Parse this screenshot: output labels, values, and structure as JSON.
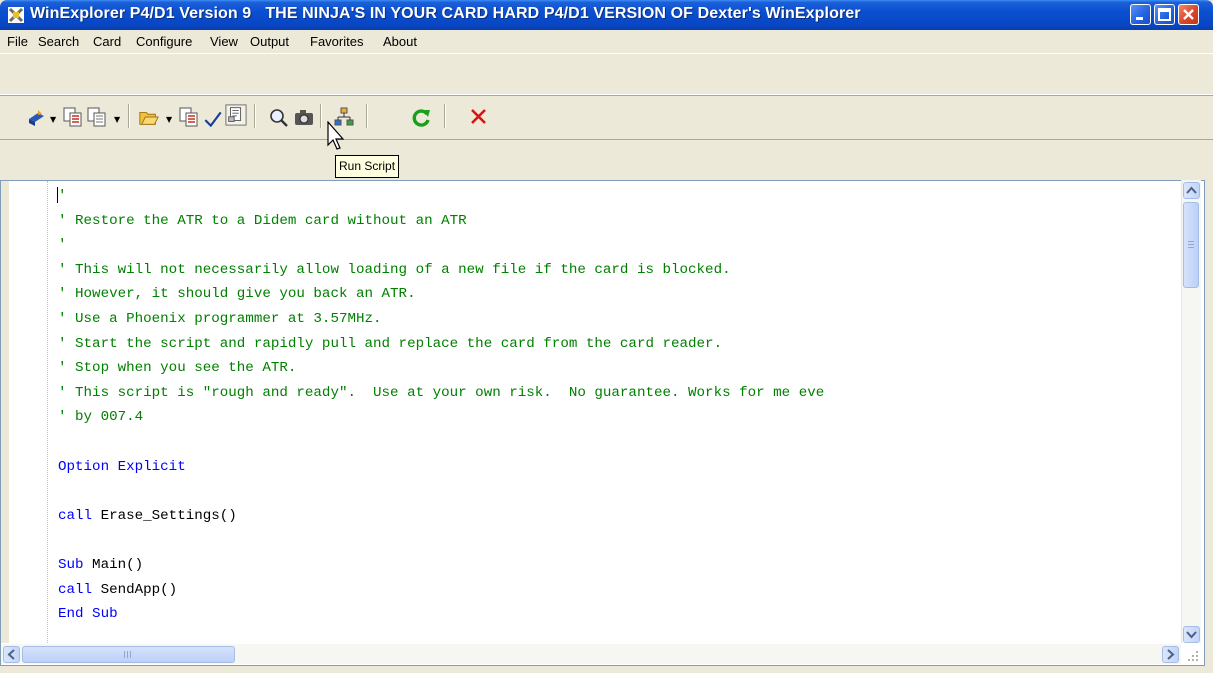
{
  "window": {
    "title_app": "WinExplorer  P4/D1  Version 9",
    "title_caption": "THE NINJA'S IN YOUR CARD HARD P4/D1 VERSION OF Dexter's WinExplorer"
  },
  "menu": {
    "items": [
      "File",
      "Search",
      "Card",
      "Configure",
      "View",
      "Output",
      "Favorites",
      "About"
    ]
  },
  "toolbar": {
    "icons": [
      "new-icon",
      "copy-file-icon",
      "duplicate-icon",
      "open-folder-icon",
      "save-icon",
      "check-icon",
      "run-script-icon",
      "search-icon",
      "camera-icon",
      "tree-icon",
      "refresh-icon",
      "stop-icon"
    ],
    "tooltip": "Run Script"
  },
  "editor": {
    "lines": [
      {
        "text": "'",
        "type": "comment"
      },
      {
        "text": "' Restore the ATR to a Didem card without an ATR",
        "type": "comment"
      },
      {
        "text": "'",
        "type": "comment"
      },
      {
        "text": "' This will not necessarily allow loading of a new file if the card is blocked.",
        "type": "comment"
      },
      {
        "text": "' However, it should give you back an ATR.",
        "type": "comment"
      },
      {
        "text": "' Use a Phoenix programmer at 3.57MHz.",
        "type": "comment"
      },
      {
        "text": "' Start the script and rapidly pull and replace the card from the card reader.",
        "type": "comment"
      },
      {
        "text": "' Stop when you see the ATR.",
        "type": "comment"
      },
      {
        "text": "' This script is \"rough and ready\".  Use at your own risk.  No guarantee. Works for me eve",
        "type": "comment"
      },
      {
        "text": "' by 007.4",
        "type": "comment"
      },
      {
        "text": "",
        "type": "plain"
      },
      {
        "text": "Option Explicit",
        "type": "keyword"
      },
      {
        "text": "",
        "type": "plain"
      },
      {
        "text": "call Erase_Settings()",
        "type": "mixed",
        "kw": "call",
        "rest": " Erase_Settings()"
      },
      {
        "text": "",
        "type": "plain"
      },
      {
        "text": "Sub Main()",
        "type": "mixed",
        "kw": "Sub",
        "rest": " Main()"
      },
      {
        "text": "call SendApp()",
        "type": "mixed",
        "kw": "call",
        "rest": " SendApp()"
      },
      {
        "text": "End Sub",
        "type": "keyword"
      }
    ]
  },
  "colors": {
    "comment": "#008000",
    "keyword": "#0000ff",
    "titlebar": "#0a4fd0"
  }
}
